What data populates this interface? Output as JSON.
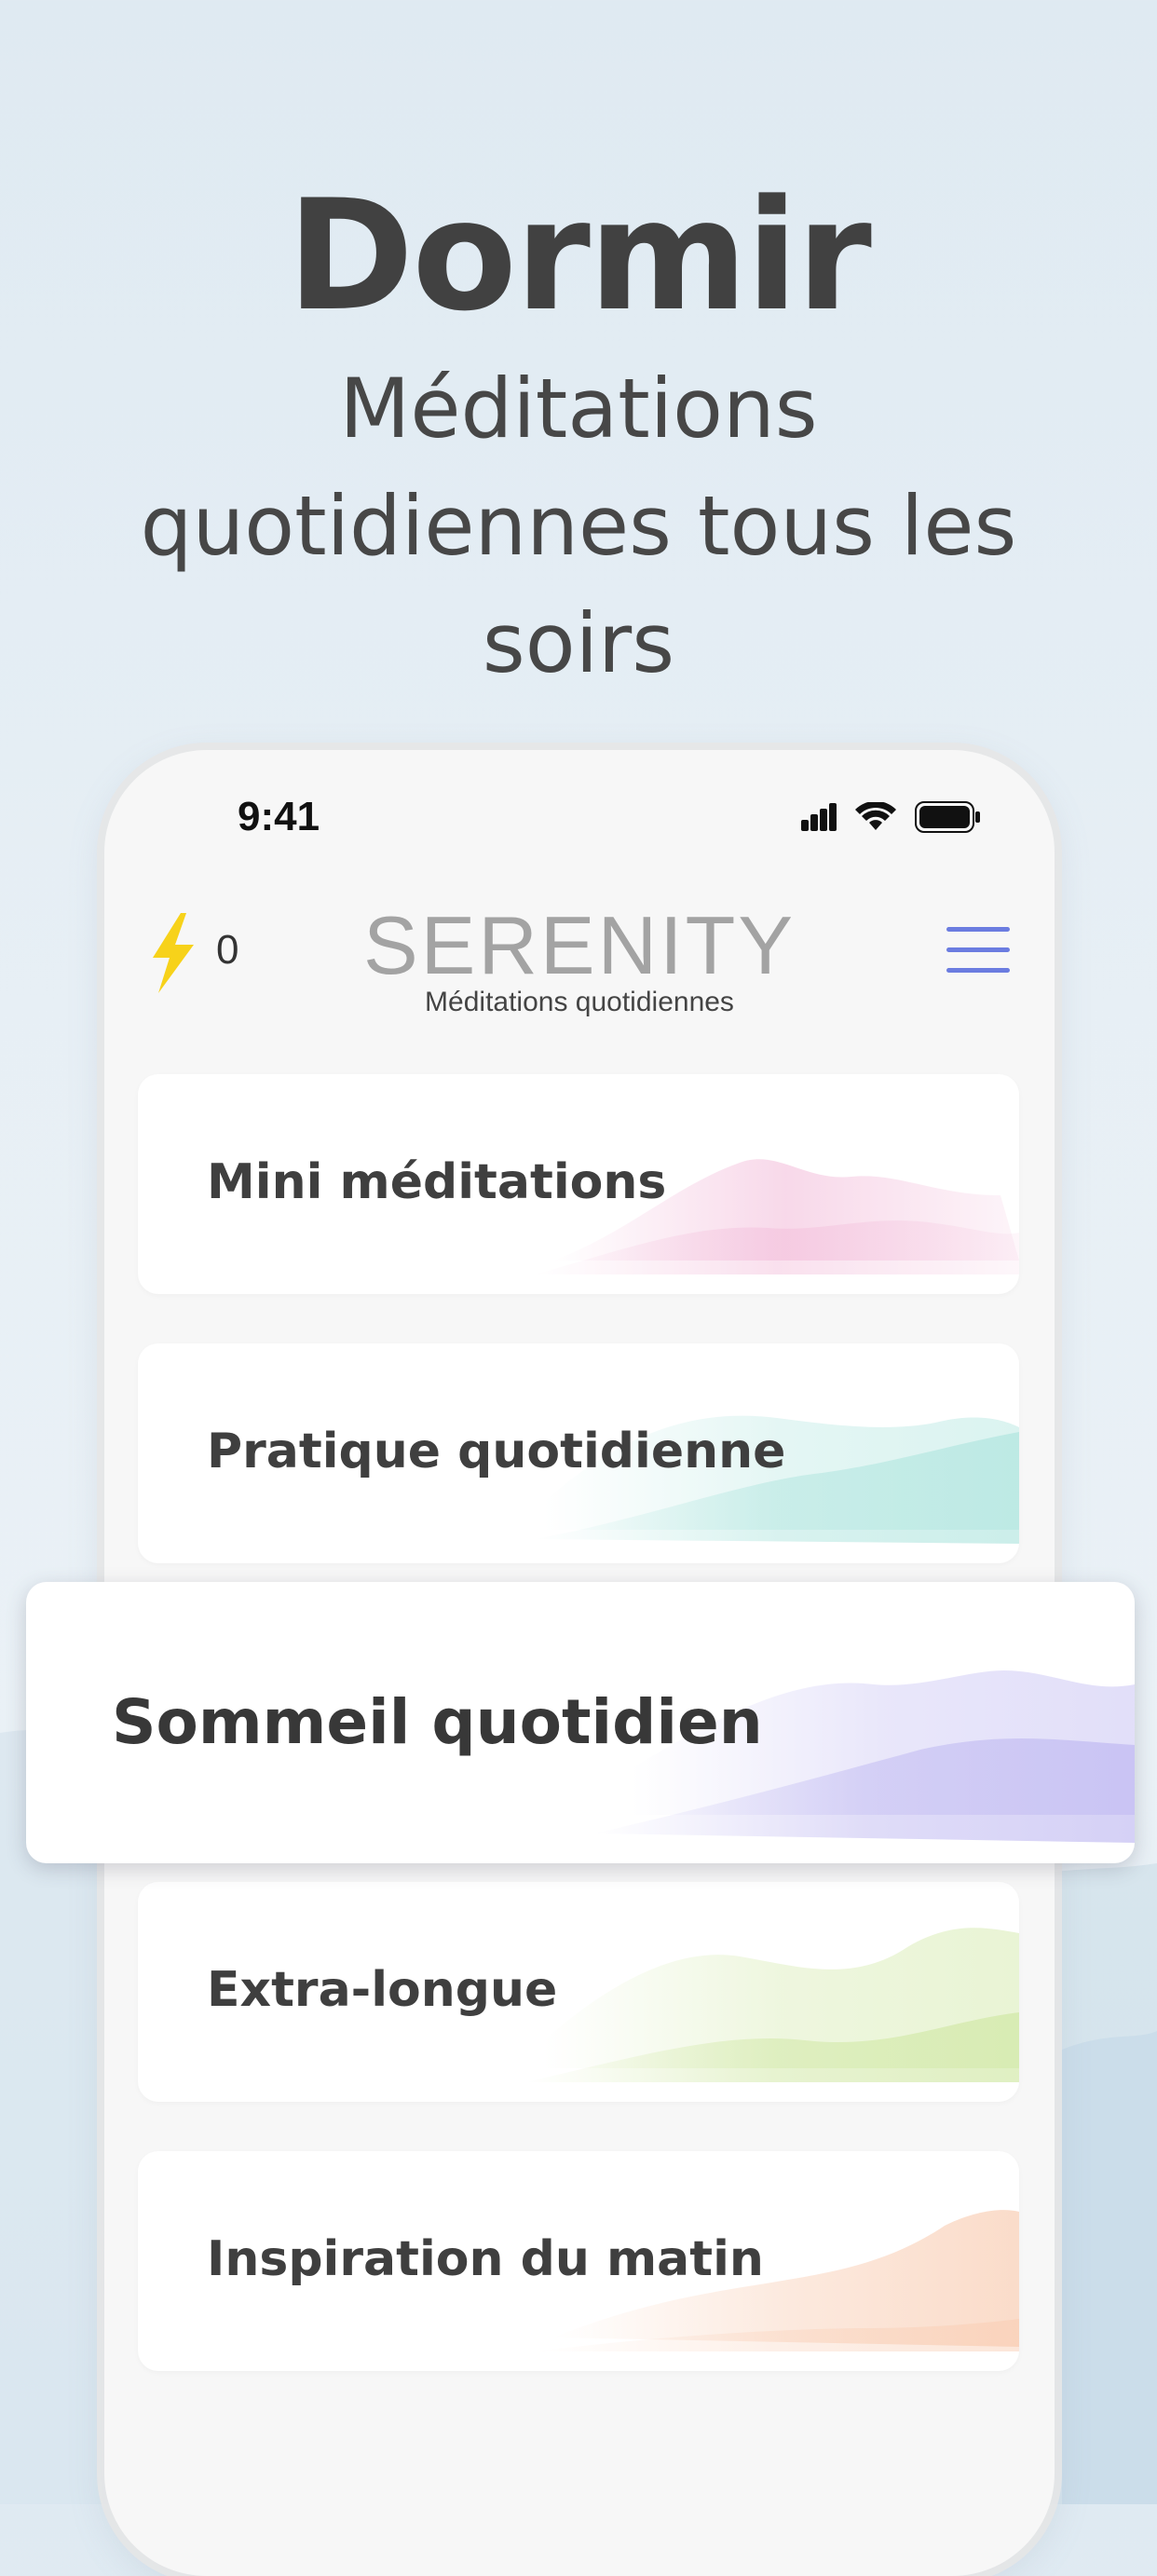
{
  "headline": {
    "title": "Dormir",
    "subtitle": "Méditations quotidiennes tous les soirs"
  },
  "status_bar": {
    "time": "9:41",
    "icons": [
      "signal-icon",
      "wifi-icon",
      "battery-icon"
    ]
  },
  "header": {
    "points": "0",
    "points_icon": "lightning-bolt-icon",
    "brand": "SERENITY",
    "tagline": "Méditations quotidiennes",
    "menu_icon": "hamburger-menu-icon"
  },
  "cards": [
    {
      "label": "Mini méditations",
      "accent": "#f2b9d8"
    },
    {
      "label": "Pratique quotidienne",
      "accent": "#a9e3dc"
    },
    {
      "label": "Sommeil quotidien",
      "accent": "#b9b2f0",
      "featured": true
    },
    {
      "label": "Extra-longue",
      "accent": "#cfe7a2"
    },
    {
      "label": "Inspiration du matin",
      "accent": "#f8c9ad"
    }
  ],
  "colors": {
    "bolt": "#f7d21a",
    "menu": "#6b7ce0",
    "background": "#e3edf4"
  }
}
